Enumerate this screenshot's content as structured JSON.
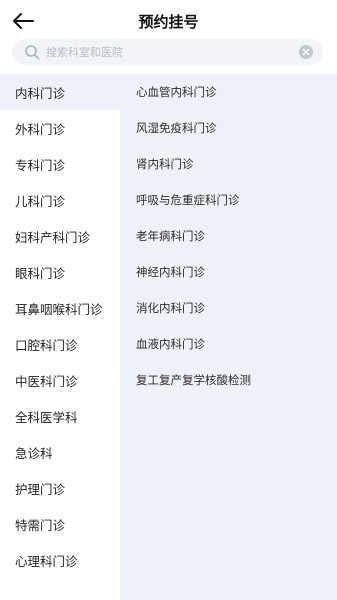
{
  "header": {
    "title": "预约挂号"
  },
  "search": {
    "placeholder": "搜索科室和医院",
    "value": ""
  },
  "left_menu": [
    "内科门诊",
    "外科门诊",
    "专科门诊",
    "儿科门诊",
    "妇科产科门诊",
    "眼科门诊",
    "耳鼻咽喉科门诊",
    "口腔科门诊",
    "中医科门诊",
    "全科医学科",
    "急诊科",
    "护理门诊",
    "特需门诊",
    "心理科门诊"
  ],
  "left_active_index": 0,
  "right_list": [
    "心血管内科门诊",
    "风湿免疫科门诊",
    "肾内科门诊",
    "呼吸与危重症科门诊",
    "老年病科门诊",
    "神经内科门诊",
    "消化内科门诊",
    "血液内科门诊",
    "复工复产复学核酸检测"
  ],
  "colors": {
    "panel_bg": "#eef1f7",
    "search_bg": "#f2f4f8"
  },
  "icons": {
    "back": "arrow-left-icon",
    "search": "search-icon",
    "clear": "clear-icon"
  }
}
